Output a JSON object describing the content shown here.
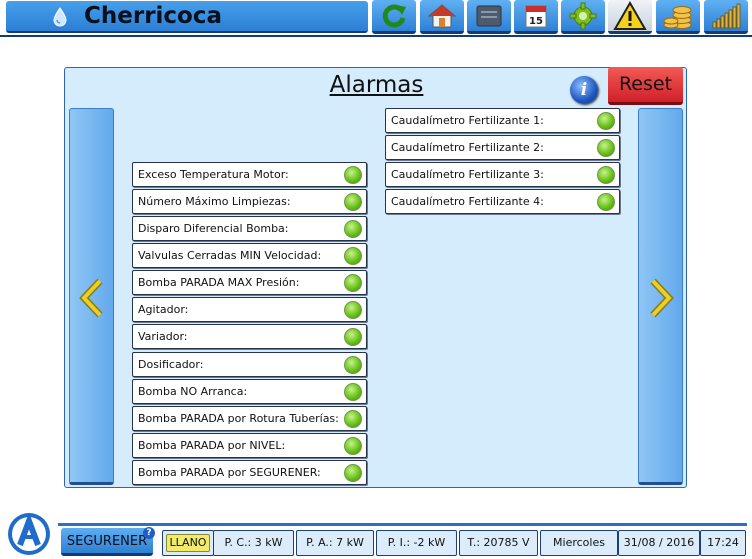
{
  "header": {
    "title": "Cherricoca",
    "toolbar": [
      {
        "name": "refresh-button",
        "icon": "refresh-icon"
      },
      {
        "name": "home-button",
        "icon": "home-icon"
      },
      {
        "name": "panel-button",
        "icon": "panel-icon"
      },
      {
        "name": "calendar-button",
        "icon": "calendar-icon",
        "label": "15"
      },
      {
        "name": "settings-button",
        "icon": "gear-icon"
      },
      {
        "name": "alarms-button",
        "icon": "warning-icon",
        "active": true
      },
      {
        "name": "costs-button",
        "icon": "coins-icon"
      },
      {
        "name": "signal-button",
        "icon": "signal-bars-icon"
      }
    ]
  },
  "panel": {
    "title": "Alarmas",
    "reset_label": "Reset",
    "info_label": "i",
    "left_alarms": [
      "Exceso Temperatura Motor:",
      "Número Máximo Limpiezas:",
      "Disparo Diferencial Bomba:",
      "Valvulas Cerradas MIN Velocidad:",
      "Bomba PARADA MAX Presión:",
      "Agitador:",
      "Variador:",
      "Dosificador:",
      "Bomba NO Arranca:",
      "Bomba PARADA por Rotura Tuberías:",
      "Bomba PARADA por NIVEL:",
      "Bomba PARADA por SEGURENER:"
    ],
    "right_alarms": [
      "Caudalímetro Fertilizante 1:",
      "Caudalímetro Fertilizante 2:",
      "Caudalímetro Fertilizante 3:",
      "Caudalímetro Fertilizante 4:"
    ],
    "led_color": "#6bc21c"
  },
  "footer": {
    "brand_button": "SEGURENER",
    "help_badge": "?",
    "tariff": "LLANO",
    "pc": "P. C.: 3 kW",
    "pa": "P. A.: 7 kW",
    "pi": "P. I.: -2 kW",
    "voltage": "T.: 20785 V",
    "day": "Miercoles",
    "date": "31/08 / 2016",
    "time": "17:24"
  },
  "colors": {
    "accent": "#2e80d6",
    "panel_bg": "#d4ecfb",
    "reset": "#d0202a",
    "tariff_bg": "#f1ea6a"
  }
}
